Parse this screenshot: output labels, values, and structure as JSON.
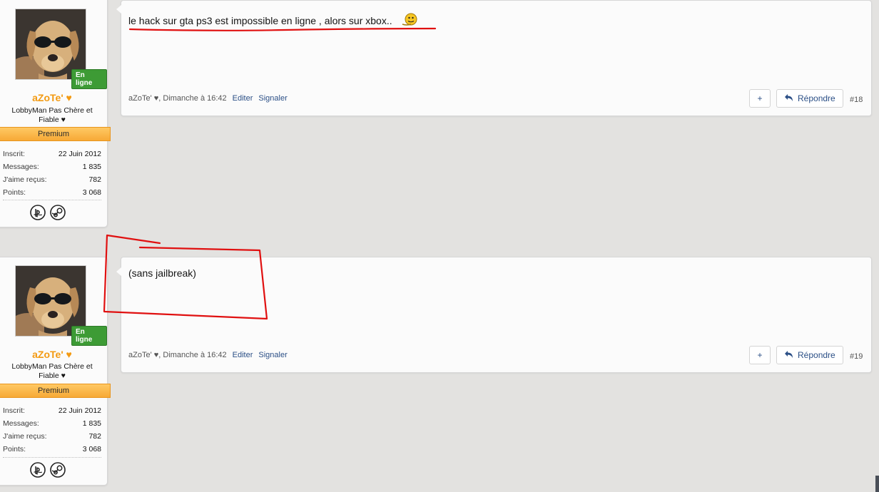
{
  "posts": [
    {
      "user": {
        "name": "aZoTe' ♥",
        "title": "LobbyMan Pas Chère et Fiable ♥",
        "online": "En ligne",
        "rank": "Premium",
        "stats": [
          {
            "label": "Inscrit:",
            "value": "22 Juin 2012"
          },
          {
            "label": "Messages:",
            "value": "1 835"
          },
          {
            "label": "J'aime reçus:",
            "value": "782"
          },
          {
            "label": "Points:",
            "value": "3 068"
          }
        ],
        "platforms": [
          "playstation-icon",
          "steam-icon"
        ]
      },
      "message": "le hack sur gta ps3 est impossible en ligne , alors sur xbox..",
      "meta": {
        "author": "aZoTe' ♥",
        "date": ", Dimanche à 16:42",
        "edit": "Editer",
        "report": "Signaler"
      },
      "plus": "+",
      "reply": "Répondre",
      "number": "#18"
    },
    {
      "user": {
        "name": "aZoTe' ♥",
        "title": "LobbyMan Pas Chère et Fiable ♥",
        "online": "En ligne",
        "rank": "Premium",
        "stats": [
          {
            "label": "Inscrit:",
            "value": "22 Juin 2012"
          },
          {
            "label": "Messages:",
            "value": "1 835"
          },
          {
            "label": "J'aime reçus:",
            "value": "782"
          },
          {
            "label": "Points:",
            "value": "3 068"
          }
        ],
        "platforms": [
          "playstation-icon",
          "steam-icon"
        ]
      },
      "message": "(sans jailbreak)",
      "meta": {
        "author": "aZoTe' ♥",
        "date": ", Dimanche à 16:42",
        "edit": "Editer",
        "report": "Signaler"
      },
      "plus": "+",
      "reply": "Répondre",
      "number": "#19"
    }
  ],
  "colors": {
    "accent_name": "#f39a12",
    "online": "#3d9b35",
    "premium": "#f7a936",
    "annotation": "#e01010",
    "link": "#2b4f86"
  }
}
